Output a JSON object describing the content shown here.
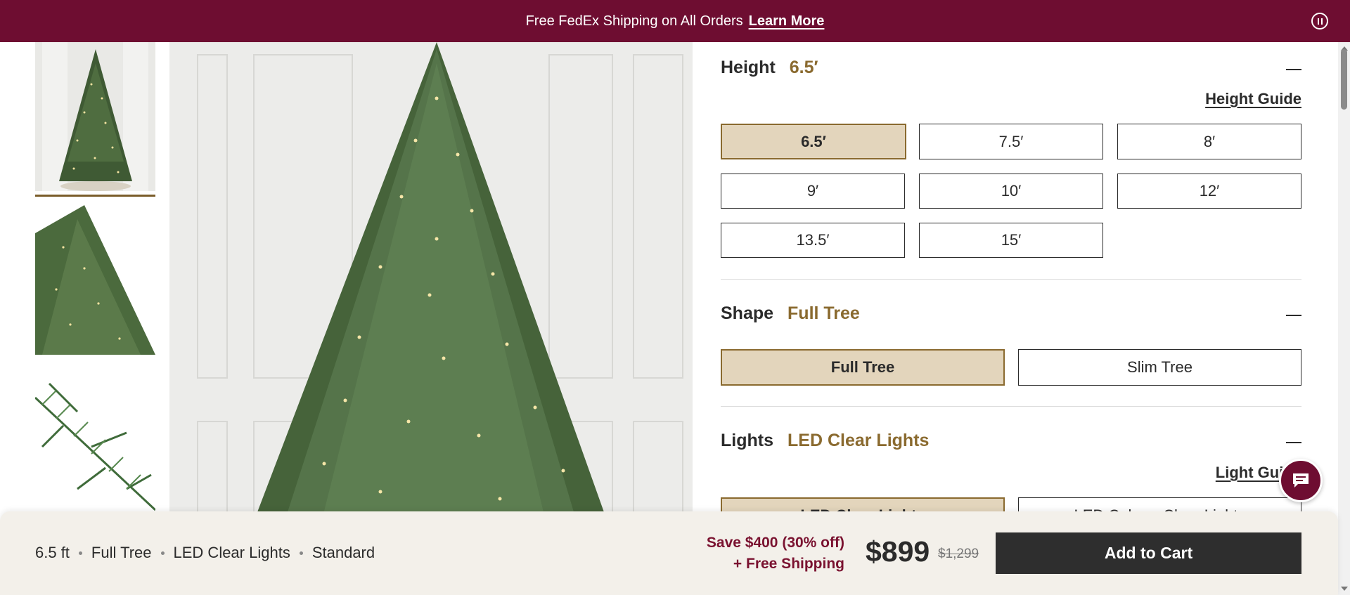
{
  "promo": {
    "text": "Free FedEx Shipping on All Orders",
    "link": "Learn More"
  },
  "options": {
    "height": {
      "label": "Height",
      "selected": "6.5′",
      "guide": "Height Guide",
      "choices": [
        "6.5′",
        "7.5′",
        "8′",
        "9′",
        "10′",
        "12′",
        "13.5′",
        "15′"
      ]
    },
    "shape": {
      "label": "Shape",
      "selected": "Full Tree",
      "choices": [
        "Full Tree",
        "Slim Tree"
      ]
    },
    "lights": {
      "label": "Lights",
      "selected": "LED Clear Lights",
      "guide": "Light Guide",
      "choices": [
        "LED Clear Lights",
        "LED Color + Clear Lights"
      ]
    }
  },
  "bottom_bar": {
    "summary": [
      "6.5 ft",
      "Full Tree",
      "LED Clear Lights",
      "Standard"
    ],
    "save_line1": "Save $400 (30% off)",
    "save_line2": "+ Free Shipping",
    "price": "$899",
    "old_price": "$1,299",
    "add_to_cart": "Add to Cart"
  },
  "colors": {
    "banner": "#6e0d31",
    "accent": "#8a6a2f",
    "selected_fill": "#e3d5bc",
    "cta": "#2e2e2e"
  },
  "icons": [
    "pause-icon",
    "chat-icon",
    "collapse-icon"
  ]
}
